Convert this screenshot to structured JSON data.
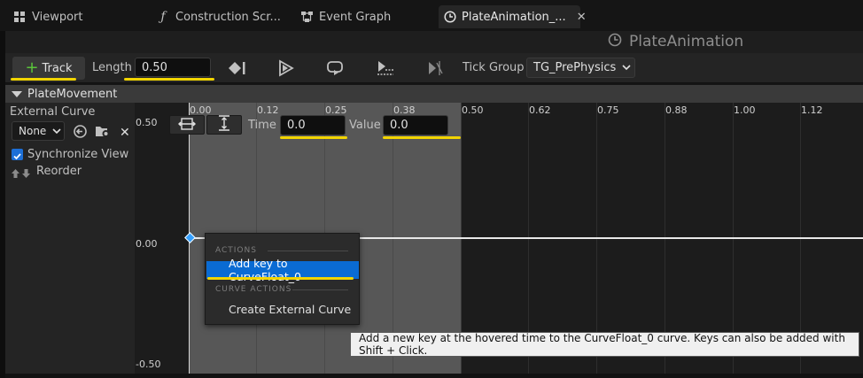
{
  "tabs": [
    {
      "label": "Viewport",
      "icon": "viewport-grid-icon"
    },
    {
      "label": "Construction Scr...",
      "icon": "function-icon"
    },
    {
      "label": "Event Graph",
      "icon": "graph-icon"
    },
    {
      "label": "PlateAnimation_...",
      "icon": "timeline-clock-icon",
      "active": true
    }
  ],
  "asset_title": "PlateAnimation",
  "toolbar": {
    "track_label": "Track",
    "length_label": "Length",
    "length_value": "0.50",
    "tick_group_label": "Tick Group",
    "tick_group_value": "TG_PrePhysics"
  },
  "track": {
    "name": "PlateMovement",
    "external_curve_label": "External Curve",
    "external_curve_value": "None",
    "sync_view_label": "Synchronize View",
    "sync_view_checked": true,
    "reorder_label": "Reorder"
  },
  "graph": {
    "time_ticks": [
      "0.00",
      "0.12",
      "0.25",
      "0.38",
      "0.50",
      "0.62",
      "0.75",
      "0.88",
      "1.00",
      "1.12"
    ],
    "value_ticks": [
      "0.50",
      "0.00",
      "-0.50"
    ],
    "time_label": "Time",
    "time_value": "0.0",
    "value_label": "Value",
    "value_value": "0.0"
  },
  "context_menu": {
    "actions_header": "ACTIONS",
    "add_key_label": "Add key to CurveFloat_0",
    "curve_actions_header": "CURVE ACTIONS",
    "create_external_label": "Create External Curve"
  },
  "tooltip": "Add a new key at the hovered time to the CurveFloat_0 curve.  Keys can also be added with Shift + Click.",
  "colors": {
    "accent_blue": "#0a6bd3",
    "highlight_yellow": "#f1d400",
    "track_plus_green": "#5ac43a"
  }
}
